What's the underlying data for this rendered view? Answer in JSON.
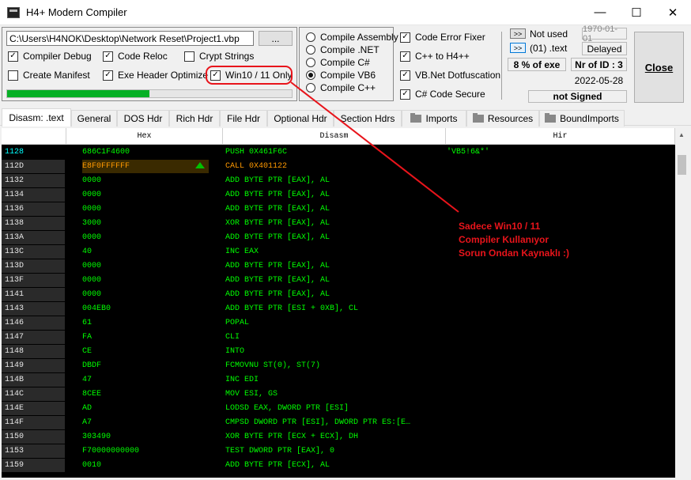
{
  "window": {
    "title": "H4+ Modern Compiler",
    "minimize": "—",
    "maximize": "☐",
    "close": "✕"
  },
  "project": {
    "path": "C:\\Users\\H4NOK\\Desktop\\Network Reset\\Project1.vbp",
    "browse_label": "..."
  },
  "options_left": [
    {
      "label": "Compiler Debug",
      "checked": "✓"
    },
    {
      "label": "Code Reloc",
      "checked": "✓"
    },
    {
      "label": "Crypt Strings",
      "checked": ""
    },
    {
      "label": "Create Manifest",
      "checked": ""
    },
    {
      "label": "Exe Header Optimize",
      "checked": "✓"
    },
    {
      "label": "Win10 / 11 Only",
      "checked": "✓"
    }
  ],
  "progress_percent": 50,
  "compile_modes": [
    {
      "label": "Compile Assembly",
      "selected": false
    },
    {
      "label": "Compile .NET",
      "selected": false
    },
    {
      "label": "Compile C#",
      "selected": false
    },
    {
      "label": "Compile VB6",
      "selected": true
    },
    {
      "label": "Compile C++",
      "selected": false
    }
  ],
  "options_right": [
    {
      "label": "Code  Error Fixer",
      "checked": "✓"
    },
    {
      "label": "C++ to H4++",
      "checked": "✓"
    },
    {
      "label": "VB.Net Dotfuscation",
      "checked": "✓"
    },
    {
      "label": "C# Code Secure",
      "checked": "✓"
    }
  ],
  "info": {
    "btn1": ">>",
    "not_used": "Not used",
    "date_placeholder": "1970-01-01",
    "btn2": ">>",
    "section": "(01) .text",
    "delayed": "Delayed",
    "exe_percent": "8  % of exe",
    "nr_of_id": "Nr of ID : 3",
    "date": "2022-05-28",
    "signed": "not Signed"
  },
  "close_button": "Close",
  "tabs": [
    {
      "label": "Disasm: .text",
      "icon": ""
    },
    {
      "label": "General",
      "icon": ""
    },
    {
      "label": "DOS Hdr",
      "icon": ""
    },
    {
      "label": "Rich Hdr",
      "icon": ""
    },
    {
      "label": "File Hdr",
      "icon": ""
    },
    {
      "label": "Optional Hdr",
      "icon": ""
    },
    {
      "label": "Section Hdrs",
      "icon": ""
    },
    {
      "label": "Imports",
      "icon": "folder-icon"
    },
    {
      "label": "Resources",
      "icon": "folder-icon"
    },
    {
      "label": "BoundImports",
      "icon": "folder-icon"
    }
  ],
  "columns": {
    "hex": "Hex",
    "disasm": "Disasm",
    "hir": "Hir"
  },
  "rows": [
    {
      "addr": "1128",
      "hex": "686C1F4600",
      "dis": "PUSH 0X461F6C",
      "hir": "'VB5!6&*'"
    },
    {
      "addr": "112D",
      "hex": "E8F0FFFFFF",
      "dis": "CALL 0X401122",
      "hir": ""
    },
    {
      "addr": "1132",
      "hex": "0000",
      "dis": "ADD BYTE PTR [EAX], AL",
      "hir": ""
    },
    {
      "addr": "1134",
      "hex": "0000",
      "dis": "ADD BYTE PTR [EAX], AL",
      "hir": ""
    },
    {
      "addr": "1136",
      "hex": "0000",
      "dis": "ADD BYTE PTR [EAX], AL",
      "hir": ""
    },
    {
      "addr": "1138",
      "hex": "3000",
      "dis": "XOR BYTE PTR [EAX], AL",
      "hir": ""
    },
    {
      "addr": "113A",
      "hex": "0000",
      "dis": "ADD BYTE PTR [EAX], AL",
      "hir": ""
    },
    {
      "addr": "113C",
      "hex": "40",
      "dis": "INC EAX",
      "hir": ""
    },
    {
      "addr": "113D",
      "hex": "0000",
      "dis": "ADD BYTE PTR [EAX], AL",
      "hir": ""
    },
    {
      "addr": "113F",
      "hex": "0000",
      "dis": "ADD BYTE PTR [EAX], AL",
      "hir": ""
    },
    {
      "addr": "1141",
      "hex": "0000",
      "dis": "ADD BYTE PTR [EAX], AL",
      "hir": ""
    },
    {
      "addr": "1143",
      "hex": "004EB0",
      "dis": "ADD BYTE PTR [ESI + 0XB], CL",
      "hir": ""
    },
    {
      "addr": "1146",
      "hex": "61",
      "dis": "POPAL",
      "hir": ""
    },
    {
      "addr": "1147",
      "hex": "FA",
      "dis": "CLI",
      "hir": ""
    },
    {
      "addr": "1148",
      "hex": "CE",
      "dis": "INTO",
      "hir": ""
    },
    {
      "addr": "1149",
      "hex": "DBDF",
      "dis": "FCMOVNU ST(0), ST(7)",
      "hir": ""
    },
    {
      "addr": "114B",
      "hex": "47",
      "dis": "INC EDI",
      "hir": ""
    },
    {
      "addr": "114C",
      "hex": "8CEE",
      "dis": "MOV ESI, GS",
      "hir": ""
    },
    {
      "addr": "114E",
      "hex": "AD",
      "dis": "LODSD EAX, DWORD PTR [ESI]",
      "hir": ""
    },
    {
      "addr": "114F",
      "hex": "A7",
      "dis": "CMPSD DWORD PTR [ESI], DWORD PTR ES:[E…",
      "hir": ""
    },
    {
      "addr": "1150",
      "hex": "303490",
      "dis": "XOR BYTE PTR [ECX + ECX], DH",
      "hir": ""
    },
    {
      "addr": "1153",
      "hex": "F70000000000",
      "dis": "TEST DWORD PTR [EAX], 0",
      "hir": ""
    },
    {
      "addr": "1159",
      "hex": "0010",
      "dis": "ADD BYTE PTR [ECX], AL",
      "hir": ""
    }
  ],
  "annotation": {
    "line1": "Sadece Win10 / 11",
    "line2": "Compiler Kullanıyor",
    "line3": "Sorun Ondan Kaynaklı :)"
  },
  "colors": {
    "annotation": "#e8141b",
    "code_green": "#00ff00",
    "progress": "#06b025"
  }
}
